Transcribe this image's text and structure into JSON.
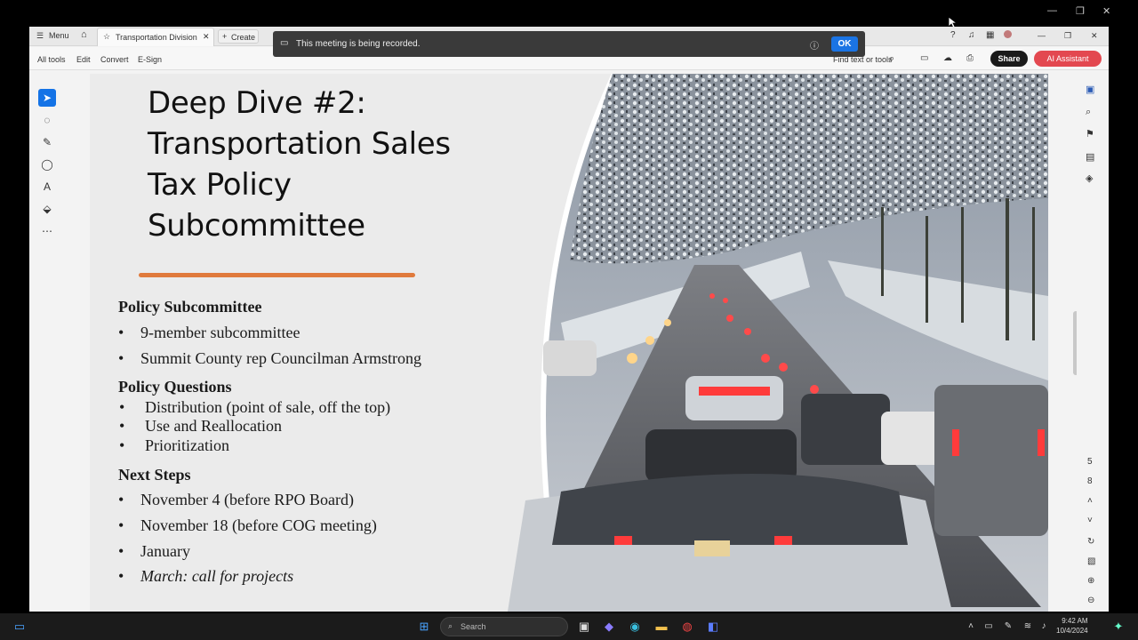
{
  "window": {
    "menu_label": "Menu",
    "tab_title": "Transportation Division",
    "create_label": "Create"
  },
  "menubar": {
    "items": [
      "All tools",
      "Edit",
      "Convert",
      "E-Sign"
    ],
    "find_text_tools": "Find text or tools",
    "share_label": "Share",
    "ai_label": "AI Assistant"
  },
  "recording": {
    "message": "This meeting is being recorded.",
    "ok_label": "OK"
  },
  "slide": {
    "title_lines": [
      "Deep Dive #2:",
      "Transportation Sales",
      "Tax Policy",
      "Subcommittee"
    ],
    "accent_color": "#e07a3c",
    "sections": [
      {
        "heading": "Policy Subcommittee",
        "items": [
          "9-member subcommittee",
          "Summit County rep Councilman Armstrong"
        ]
      },
      {
        "heading": "Policy Questions",
        "items": [
          "Distribution (point of sale, off the top)",
          "Use and Reallocation",
          "Prioritization"
        ]
      },
      {
        "heading": "Next Steps",
        "items": [
          "November 4 (before RPO Board)",
          "November 18 (before COG meeting)",
          "January",
          "March: call for projects"
        ]
      }
    ]
  },
  "page_nav": {
    "current": "5",
    "total": "8"
  },
  "taskbar": {
    "search_placeholder": "Search",
    "time": "9:42 AM",
    "date": "10/4/2024"
  }
}
